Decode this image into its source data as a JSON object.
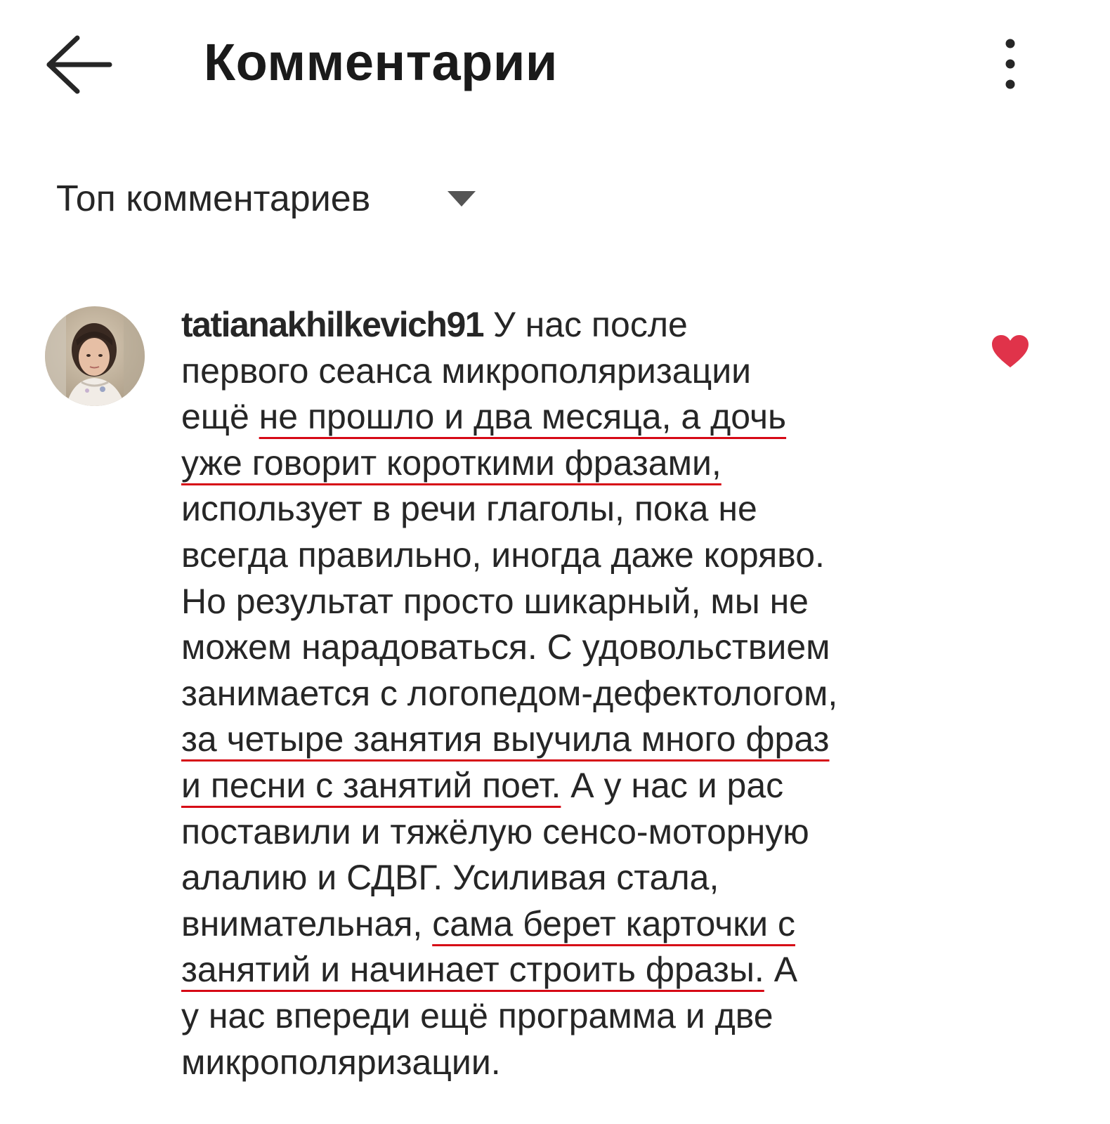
{
  "header": {
    "title": "Комментарии",
    "back_icon": "arrow-left-icon",
    "more_icon": "more-vertical-icon"
  },
  "sort": {
    "label": "Топ комментариев",
    "caret_icon": "caret-down-icon"
  },
  "comment": {
    "username": "tatianakhilkevich91",
    "liked": true,
    "like_icon": "heart-icon",
    "like_color": "#e0334a",
    "underline_color": "#d60a16",
    "lines": [
      [
        {
          "t": " У нас после",
          "u": false
        }
      ],
      [
        {
          "t": "первого сеанса микрополяризации",
          "u": false
        }
      ],
      [
        {
          "t": "ещё ",
          "u": false
        },
        {
          "t": "не прошло и два месяца, а дочь",
          "u": true
        }
      ],
      [
        {
          "t": "уже говорит короткими фразами,",
          "u": true
        }
      ],
      [
        {
          "t": "использует в речи глаголы, пока не",
          "u": false
        }
      ],
      [
        {
          "t": "всегда правильно, иногда даже коряво.",
          "u": false
        }
      ],
      [
        {
          "t": "Но результат просто шикарный, мы не",
          "u": false
        }
      ],
      [
        {
          "t": "можем нарадоваться. С удовольствием",
          "u": false
        }
      ],
      [
        {
          "t": "занимается с логопедом-дефектологом,",
          "u": false
        }
      ],
      [
        {
          "t": "за четыре занятия выучила много фраз",
          "u": true
        }
      ],
      [
        {
          "t": "и песни с занятий поет.",
          "u": true
        },
        {
          "t": " А у нас и рас",
          "u": false
        }
      ],
      [
        {
          "t": "поставили и тяжёлую сенсо-моторную",
          "u": false
        }
      ],
      [
        {
          "t": "алалию  и СДВГ. Усиливая стала,",
          "u": false
        }
      ],
      [
        {
          "t": "внимательная, ",
          "u": false
        },
        {
          "t": "сама берет карточки с",
          "u": true
        }
      ],
      [
        {
          "t": "занятий и начинает строить фразы.",
          "u": true
        },
        {
          "t": " А",
          "u": false
        }
      ],
      [
        {
          "t": "у нас впереди ещё программа и две",
          "u": false
        }
      ],
      [
        {
          "t": "микрополяризации.",
          "u": false
        }
      ]
    ]
  }
}
